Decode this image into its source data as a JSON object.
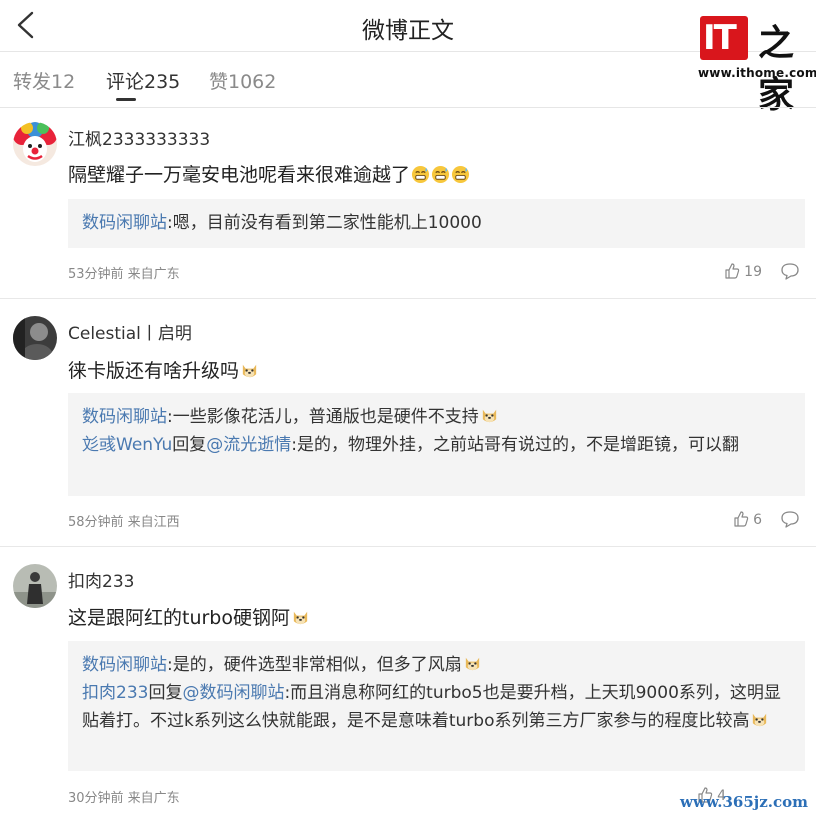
{
  "header": {
    "title": "微博正文"
  },
  "logo": {
    "it_text": "IT",
    "zh_text": "之家",
    "url": "www.ithome.com"
  },
  "tabs": [
    {
      "label": "转发12"
    },
    {
      "label": "评论235"
    },
    {
      "label": "赞1062"
    }
  ],
  "comments": [
    {
      "user": "江枫2333333333",
      "text": "隔壁耀子一万毫安电池呢看来很难逾越了",
      "replies": [
        {
          "name": "数码闲聊站",
          "text": ":嗯，目前没有看到第二家性能机上10000"
        }
      ],
      "time": "53分钟前 来自广东",
      "likes": "19"
    },
    {
      "user": "Celestial丨启明",
      "text": "徕卡版还有啥升级吗",
      "replies": [
        {
          "name": "数码闲聊站",
          "text": ":一些影像花活儿，普通版也是硬件不支持"
        },
        {
          "name": "彣彧WenYu",
          "reply_word": "回复",
          "target": "@流光逝情",
          "text": ":是的，物理外挂，之前站哥有说过的，不是增距镜，可以翻"
        }
      ],
      "time": "58分钟前 来自江西",
      "likes": "6"
    },
    {
      "user": "扣肉233",
      "text": "这是跟阿红的turbo硬钢阿",
      "replies": [
        {
          "name": "数码闲聊站",
          "text": ":是的，硬件选型非常相似，但多了风扇"
        },
        {
          "name": "扣肉233",
          "reply_word": "回复",
          "target": "@数码闲聊站",
          "text": ":而且消息称阿红的turbo5也是要升档，上天玑9000系列，这明显贴着打。不过k系列这么快就能跟，是不是意味着turbo系列第三方厂家参与的程度比较高"
        }
      ],
      "time": "30分钟前 来自广东",
      "likes": "4"
    }
  ],
  "watermark": "www.365jz.com",
  "icons": {
    "back": "chevron-left-icon",
    "like": "thumb-up-icon",
    "reply": "comment-bubble-icon",
    "emoji": "sweat-smile-emoji-icon, doge-emoji-icon"
  },
  "colors": {
    "link": "#4a79b0",
    "brand_red": "#d9161c",
    "watermark": "#2c6fb7"
  }
}
